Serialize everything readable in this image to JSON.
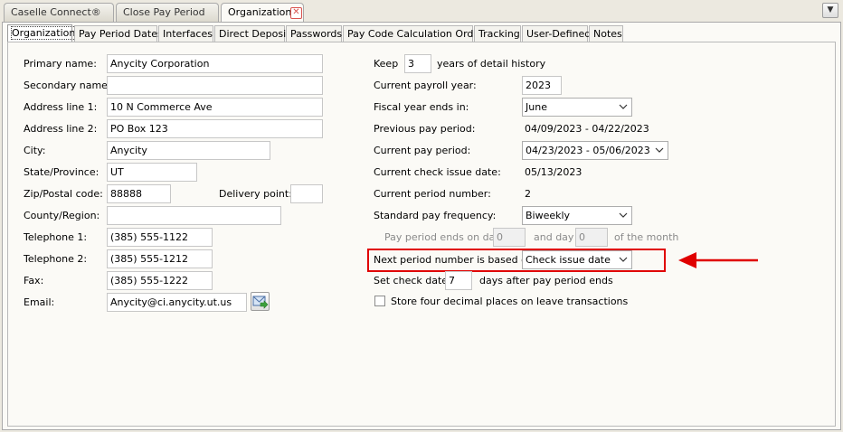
{
  "doc_tabs": [
    {
      "label": "Caselle Connect®"
    },
    {
      "label": "Close Pay Period"
    },
    {
      "label": "Organization"
    }
  ],
  "sub_tabs": [
    {
      "label": "Organization"
    },
    {
      "label": "Pay Period Dates"
    },
    {
      "label": "Interfaces"
    },
    {
      "label": "Direct Deposit"
    },
    {
      "label": "Passwords"
    },
    {
      "label": "Pay Code Calculation Order"
    },
    {
      "label": "Tracking"
    },
    {
      "label": "User-Defined"
    },
    {
      "label": "Notes"
    }
  ],
  "left": {
    "primary_name_label": "Primary name:",
    "primary_name": "Anycity Corporation",
    "secondary_name_label": "Secondary name:",
    "secondary_name": "",
    "address1_label": "Address line 1:",
    "address1": "10 N Commerce Ave",
    "address2_label": "Address line 2:",
    "address2": "PO Box 123",
    "city_label": "City:",
    "city": "Anycity",
    "state_label": "State/Province:",
    "state": "UT",
    "zip_label": "Zip/Postal code:",
    "zip": "88888",
    "delivery_label": "Delivery point:",
    "delivery": "",
    "county_label": "County/Region:",
    "county": "",
    "tel1_label": "Telephone 1:",
    "tel1": "(385) 555-1122",
    "tel2_label": "Telephone 2:",
    "tel2": "(385) 555-1212",
    "fax_label": "Fax:",
    "fax": "(385) 555-1222",
    "email_label": "Email:",
    "email": "Anycity@ci.anycity.ut.us"
  },
  "right": {
    "keep_label": "Keep",
    "keep": "3",
    "keep_suffix": "years of detail history",
    "payroll_year_label": "Current payroll year:",
    "payroll_year": "2023",
    "fiscal_label": "Fiscal year ends in:",
    "fiscal": "June",
    "prev_period_label": "Previous pay period:",
    "prev_period": "04/09/2023 - 04/22/2023",
    "cur_period_label": "Current pay period:",
    "cur_period": "04/23/2023 - 05/06/2023",
    "check_date_label": "Current check issue date:",
    "check_date": "05/13/2023",
    "period_number_label": "Current period number:",
    "period_number": "2",
    "frequency_label": "Standard pay frequency:",
    "frequency": "Biweekly",
    "ends_on_day_label": "Pay period ends on day",
    "ends_on_day": "0",
    "and_day_label": "and day",
    "and_day": "0",
    "of_month_label": "of the month",
    "next_period_label": "Next period number is based on:",
    "next_period": "Check issue date",
    "set_check_label": "Set check date",
    "set_check": "7",
    "set_check_suffix": "days after pay period ends",
    "decimal_label": "Store four decimal places on leave transactions"
  },
  "colors": {
    "highlight": "#e00000",
    "arrow": "#e00000"
  }
}
